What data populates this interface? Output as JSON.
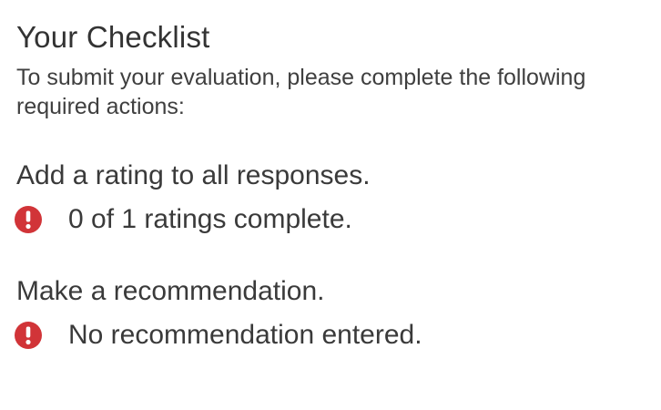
{
  "checklist": {
    "title": "Your Checklist",
    "intro": "To submit your evaluation, please complete the following required actions:",
    "tasks": [
      {
        "label": "Add a rating to all responses.",
        "status": "0 of 1 ratings complete.",
        "status_icon": "alert-circle-icon"
      },
      {
        "label": "Make a recommendation.",
        "status": "No recommendation entered.",
        "status_icon": "alert-circle-icon"
      }
    ]
  },
  "colors": {
    "alert": "#d13438",
    "text": "#3a3a3a",
    "background": "#ffffff"
  }
}
